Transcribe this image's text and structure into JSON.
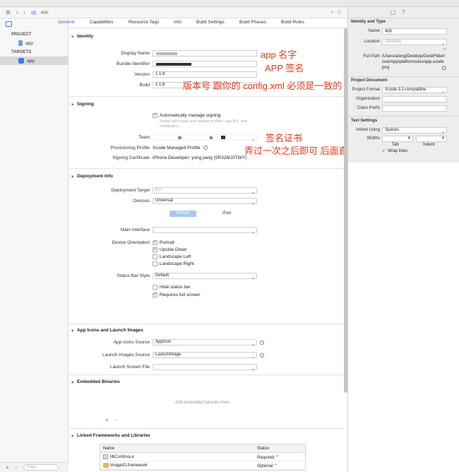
{
  "jumpbar": {
    "crumb": "app"
  },
  "navigator": {
    "project_header": "PROJECT",
    "project_item": "app",
    "targets_header": "TARGETS",
    "target_item": "app",
    "filter_placeholder": "Filter"
  },
  "tabs": [
    "General",
    "Capabilities",
    "Resource Tags",
    "Info",
    "Build Settings",
    "Build Phases",
    "Build Rules"
  ],
  "identity": {
    "header": "Identity",
    "display_name_label": "Display Name",
    "bundle_id_label": "Bundle Identifier",
    "version_label": "Version",
    "version_value": "1.1.8",
    "build_label": "Build",
    "build_value": "1.1.8"
  },
  "signing": {
    "header": "Signing",
    "auto_label": "Automatically manage signing",
    "auto_sub": "Xcode will create and update profiles, app IDs, and certificates.",
    "team_label": "Team",
    "profile_label": "Provisioning Profile",
    "profile_value": "Xcode Managed Profile",
    "cert_label": "Signing Certificate",
    "cert_value": "iPhone Developer: yong jiang (5R32MJ3TWY)"
  },
  "deployment": {
    "header": "Deployment Info",
    "target_label": "Deployment Target",
    "target_value": "8.0",
    "devices_label": "Devices",
    "devices_value": "Universal",
    "seg_iphone": "iPhone",
    "seg_ipad": "iPad",
    "main_interface_label": "Main Interface",
    "orientation_label": "Device Orientation",
    "orientations": [
      {
        "label": "Portrait",
        "checked": true
      },
      {
        "label": "Upside Down",
        "checked": true
      },
      {
        "label": "Landscape Left",
        "checked": false
      },
      {
        "label": "Landscape Right",
        "checked": false
      }
    ],
    "status_bar_label": "Status Bar Style",
    "status_bar_value": "Default",
    "hide_status_label": "Hide status bar",
    "full_screen_label": "Requires full screen"
  },
  "app_icons": {
    "header": "App Icons and Launch Images",
    "icons_source_label": "App Icons Source",
    "icons_source_value": "AppIcon",
    "launch_source_label": "Launch Images Source",
    "launch_source_value": "LaunchImage",
    "launch_screen_label": "Launch Screen File"
  },
  "embedded": {
    "header": "Embedded Binaries",
    "placeholder": "Add embedded binaries here"
  },
  "linked": {
    "header": "Linked Frameworks and Libraries",
    "col_name": "Name",
    "col_status": "Status",
    "rows": [
      {
        "name": "libCordova.a",
        "status": "Required ⌃"
      },
      {
        "name": "ImageIO.framework",
        "status": "Optional ⌃"
      }
    ]
  },
  "annotations": {
    "app_name": "app 名字",
    "app_sign": "APP 签名",
    "version_note": "版本号 跟你的 config.xml 必须是一致的",
    "cert_note": "签名证书",
    "cert_note2": "弄过一次之后即可 后面直接选择"
  },
  "inspector": {
    "identity_header": "Identity and Type",
    "name_label": "Name",
    "name_value": "app",
    "location_label": "Location",
    "location_value": "Absolute",
    "full_path_label": "Full Path",
    "full_path_value": "/Users/along/Desktop/DeskFilder/sxsl/App/platforms/ios/app.xcodeproj",
    "project_doc_header": "Project Document",
    "format_label": "Project Format",
    "format_value": "Xcode 3.2-compatible",
    "org_label": "Organization",
    "class_prefix_label": "Class Prefix",
    "text_settings_header": "Text Settings",
    "indent_using_label": "Indent Using",
    "indent_using_value": "Spaces",
    "widths_label": "Widths",
    "tab_value": "4",
    "indent_value": "4",
    "tab_label": "Tab",
    "indent_label": "Indent",
    "wrap_label": "Wrap lines"
  }
}
